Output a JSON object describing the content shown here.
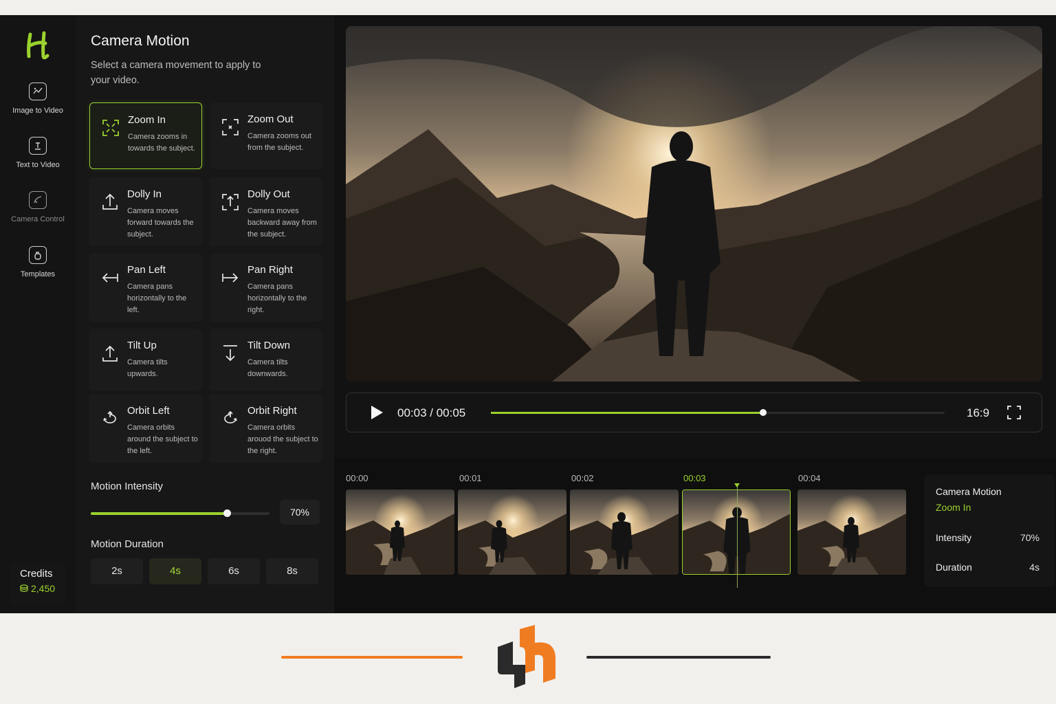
{
  "rail": {
    "items": [
      {
        "label": "Image to Video",
        "icon": "image-video-icon"
      },
      {
        "label": "Text to Video",
        "icon": "text-video-icon"
      },
      {
        "label": "Camera Control",
        "icon": "camera-control-icon"
      },
      {
        "label": "Templates",
        "icon": "templates-icon"
      }
    ],
    "credits_label": "Credits",
    "credits_value": "2,450",
    "credits_icon": "coins-icon"
  },
  "panel": {
    "title": "Camera Motion",
    "subtitle": "Select a camera movement to apply to your video.",
    "motions": [
      {
        "name": "Zoom In",
        "desc": "Camera zooms in towards the subject.",
        "icon": "zoom-in-icon",
        "active": true
      },
      {
        "name": "Zoom Out",
        "desc": "Camera zooms out from the subject.",
        "icon": "zoom-out-icon"
      },
      {
        "name": "Dolly In",
        "desc": "Camera moves forward towards the subject.",
        "icon": "dolly-in-icon"
      },
      {
        "name": "Dolly Out",
        "desc": "Camera moves backward away from the subject.",
        "icon": "dolly-out-icon"
      },
      {
        "name": "Pan Left",
        "desc": "Camera pans horizontally to the left.",
        "icon": "pan-left-icon"
      },
      {
        "name": "Pan Right",
        "desc": "Camera pans horizontally to the right.",
        "icon": "pan-right-icon"
      },
      {
        "name": "Tilt Up",
        "desc": "Camera tilts upwards.",
        "icon": "tilt-up-icon"
      },
      {
        "name": "Tilt Down",
        "desc": "Camera tilts downwards.",
        "icon": "tilt-down-icon"
      },
      {
        "name": "Orbit Left",
        "desc": "Camera orbits around the subject to the left.",
        "icon": "orbit-left-icon"
      },
      {
        "name": "Orbit Right",
        "desc": "Camera orbits arouod the subject to the right.",
        "icon": "orbit-right-icon"
      }
    ],
    "intensity_label": "Motion Intensity",
    "intensity_value": "70%",
    "intensity_fraction": 0.76,
    "duration_label": "Motion Duration",
    "durations": [
      "2s",
      "4s",
      "6s",
      "8s"
    ],
    "duration_selected": "4s"
  },
  "player": {
    "timecode": "00:03 / 00:05",
    "progress": 0.6,
    "aspect": "16:9",
    "play_icon": "play-icon",
    "fullscreen_icon": "fullscreen-icon"
  },
  "timeline": {
    "ticks": [
      "00:00",
      "00:01",
      "00:02",
      "00:03",
      "00:04"
    ],
    "current": "00:03"
  },
  "summary": {
    "motion_label": "Camera Motion",
    "motion_value": "Zoom In",
    "intensity_label": "Intensity",
    "intensity_value": "70%",
    "duration_label": "Duration",
    "duration_value": "4s"
  },
  "colors": {
    "accent": "#9bd22e",
    "brand_orange": "#f07c22",
    "brand_dark": "#2a2a2a"
  }
}
